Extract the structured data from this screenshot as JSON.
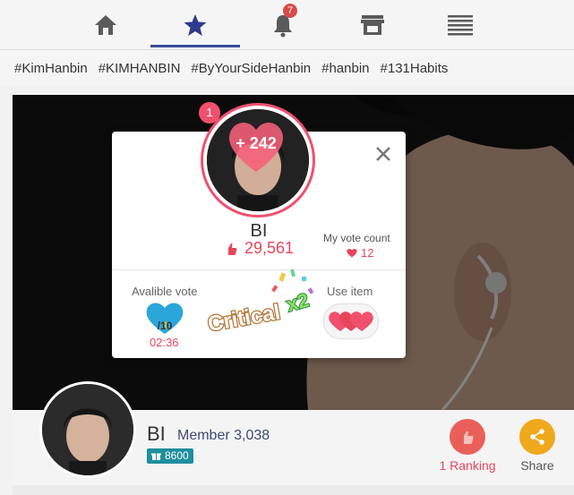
{
  "nav": {
    "items": [
      {
        "icon": "home-icon",
        "active": false
      },
      {
        "icon": "star-icon",
        "active": true
      },
      {
        "icon": "bell-icon",
        "active": false,
        "badge": "7"
      },
      {
        "icon": "store-icon",
        "active": false
      },
      {
        "icon": "list-icon",
        "active": false
      }
    ]
  },
  "hashtags": [
    "#KimHanbin",
    "#KIMHANBIN",
    "#ByYourSideHanbin",
    "#hanbin",
    "#131Habits"
  ],
  "profile": {
    "name": "BI",
    "member_label": "Member 3,038",
    "gift_count": "8600",
    "ranking_label": "1 Ranking",
    "share_label": "Share"
  },
  "vote_modal": {
    "rank_badge": "1",
    "plus_votes": "+ 242",
    "name": "BI",
    "total_votes": "29,561",
    "my_vote_label": "My vote count",
    "my_vote_count": "12",
    "available_label": "Avalible vote",
    "available_current": "3",
    "available_total": "/10",
    "timer": "02:36",
    "critical_text": "Critical",
    "critical_multiplier": "x2",
    "use_item_label": "Use item"
  },
  "colors": {
    "accent": "#3b4b9b",
    "pink": "#f0506e",
    "vote_red": "#e8455c",
    "teal": "#1f8f9e",
    "ranking_circle": "#e9605a",
    "share_circle": "#f0a81c"
  }
}
